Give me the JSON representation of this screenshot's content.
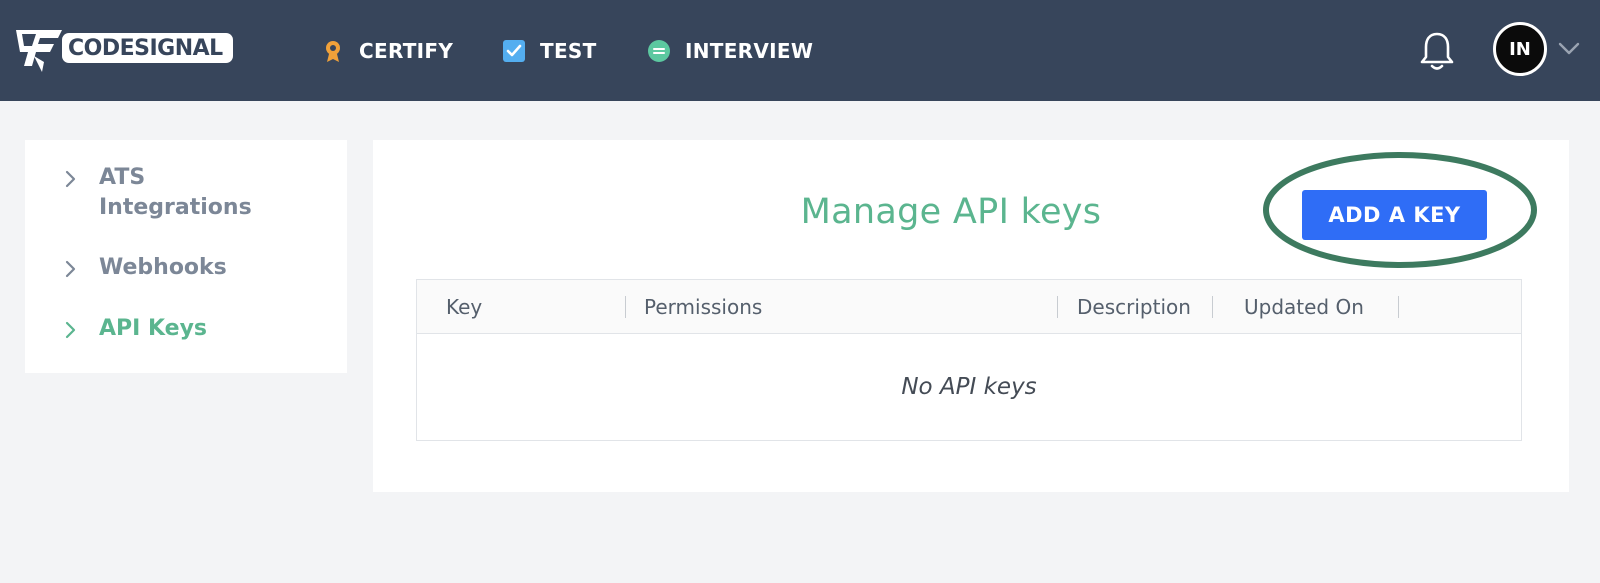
{
  "header": {
    "logo_text": "CODESIGNAL",
    "nav": [
      {
        "label": "CERTIFY",
        "icon": "award-ribbon-icon"
      },
      {
        "label": "TEST",
        "icon": "checkbox-icon"
      },
      {
        "label": "INTERVIEW",
        "icon": "chat-icon"
      }
    ],
    "notifications_icon": "bell-icon",
    "avatar_initials": "IN"
  },
  "sidebar": {
    "items": [
      {
        "label": "ATS Integrations",
        "active": false
      },
      {
        "label": "Webhooks",
        "active": false
      },
      {
        "label": "API Keys",
        "active": true
      }
    ]
  },
  "main": {
    "title": "Manage API keys",
    "add_button_label": "ADD A KEY",
    "table": {
      "columns": [
        "Key",
        "Permissions",
        "Description",
        "Updated On"
      ],
      "empty_message": "No API keys"
    }
  },
  "colors": {
    "topbar": "#37455b",
    "accent_green": "#5bb58f",
    "button_blue": "#2f6df6",
    "highlight_ring": "#3d7a5f"
  }
}
